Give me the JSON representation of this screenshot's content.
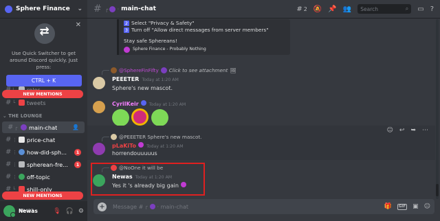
{
  "server": {
    "name": "Sphere Finance"
  },
  "quick_switcher": {
    "text": "Use Quick Switcher to get around Discord quickly. Just press:",
    "shortcut": "CTRL + K"
  },
  "sidebar": {
    "new_mentions": "NEW MENTIONS",
    "category": "THE LOUNGE",
    "channels": [
      {
        "name": "roles",
        "badge": ""
      },
      {
        "name": "tweets",
        "badge": ""
      },
      {
        "name": "main-chat",
        "badge": ""
      },
      {
        "name": "price-chat",
        "badge": ""
      },
      {
        "name": "how-did-sph...",
        "badge": "1"
      },
      {
        "name": "spherean-fre...",
        "badge": "1"
      },
      {
        "name": "off-topic",
        "badge": ""
      },
      {
        "name": "shill-only",
        "badge": ""
      }
    ]
  },
  "user": {
    "name": "Newas",
    "tag": "#0437"
  },
  "header": {
    "channel": "main-chat",
    "thread_count": "2",
    "search_placeholder": "Search"
  },
  "embed": {
    "lines": [
      {
        "num": "2",
        "text": "Select \"Privacy & Safety\""
      },
      {
        "num": "3",
        "text": "Turn off \"Allow direct messages from server members\""
      }
    ],
    "closing": "Stay safe Sphereans!",
    "footer": "Sphere Finance - Probably Nothing"
  },
  "messages": [
    {
      "reply_user": "@SphereFinFifty",
      "reply_text": "Click to see attachment",
      "user": "PEEETER",
      "time": "Today at 1:20 AM",
      "text": "Sphere's new mascot."
    },
    {
      "user": "CyrilKeir",
      "time": "Today at 1:20 AM"
    },
    {
      "reply_user": "@PEEETER",
      "reply_text": "Sphere's new mascot.",
      "user": "pLaKiTo",
      "time": "Today at 1:20 AM",
      "text": "horrendouuuuus"
    },
    {
      "reply_user": "@NoOne",
      "reply_text": "it will be",
      "user": "Newas",
      "time": "Today at 1:20 AM",
      "text": "Yes it 's already big gain"
    }
  ],
  "composer": {
    "placeholder_prefix": "Message #",
    "placeholder_channel": "main-chat"
  },
  "colors": {
    "accent": "#5865f2",
    "mention": "#ed4245",
    "highlight_box": "#e02020",
    "cyrilkeir": "#f47fff",
    "plakito": "#ed4245",
    "newas": "#ffffff"
  }
}
